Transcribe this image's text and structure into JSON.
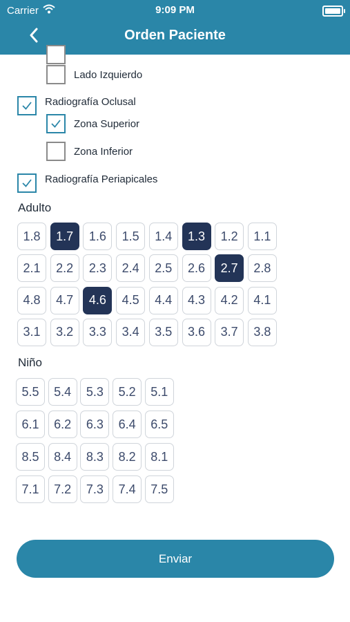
{
  "status_bar": {
    "carrier": "Carrier",
    "time": "9:09 PM"
  },
  "navbar": {
    "title": "Orden Paciente",
    "back_icon": "chevron-left-icon"
  },
  "checkboxes": [
    {
      "label": "",
      "checked": false
    },
    {
      "label": "Lado Izquierdo",
      "checked": false
    },
    {
      "label": "Radiografía Oclusal",
      "checked": true
    },
    {
      "label": "Zona Superior",
      "checked": true
    },
    {
      "label": "Zona Inferior",
      "checked": false
    },
    {
      "label": "Radiografía Periapicales",
      "checked": true
    }
  ],
  "adulto": {
    "title": "Adulto",
    "rows": [
      [
        "1.8",
        "1.7",
        "1.6",
        "1.5",
        "1.4",
        "1.3",
        "1.2",
        "1.1"
      ],
      [
        "2.1",
        "2.2",
        "2.3",
        "2.4",
        "2.5",
        "2.6",
        "2.7",
        "2.8"
      ],
      [
        "4.8",
        "4.7",
        "4.6",
        "4.5",
        "4.4",
        "4.3",
        "4.2",
        "4.1"
      ],
      [
        "3.1",
        "3.2",
        "3.3",
        "3.4",
        "3.5",
        "3.6",
        "3.7",
        "3.8"
      ]
    ],
    "selected": [
      "1.7",
      "1.3",
      "2.7",
      "4.6"
    ]
  },
  "nino": {
    "title": "Niño",
    "rows": [
      [
        "5.5",
        "5.4",
        "5.3",
        "5.2",
        "5.1"
      ],
      [
        "6.1",
        "6.2",
        "6.3",
        "6.4",
        "6.5"
      ],
      [
        "8.5",
        "8.4",
        "8.3",
        "8.2",
        "8.1"
      ],
      [
        "7.1",
        "7.2",
        "7.3",
        "7.4",
        "7.5"
      ]
    ],
    "selected": []
  },
  "submit": {
    "label": "Enviar"
  },
  "colors": {
    "accent": "#2a86a8",
    "selected_tooth": "#233457",
    "tooth_text": "#3c4a6b"
  }
}
